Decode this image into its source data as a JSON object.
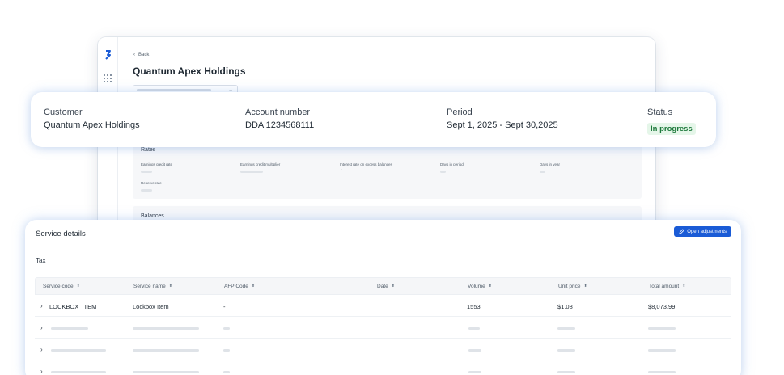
{
  "app": {
    "back_label": "Back",
    "company_title": "Quantum Apex Holdings",
    "rates_title": "Rates",
    "rates_labels": [
      "Earnings credit rate",
      "Earnings credit multiplier",
      "Interest rate on excess balances",
      "Days in period",
      "Days in year",
      "Reserve rate"
    ],
    "rates_dash": "-",
    "balances_title": "Balances"
  },
  "info": {
    "customer_label": "Customer",
    "customer_value": "Quantum Apex Holdings",
    "account_label": "Account number",
    "account_value": "DDA 1234568111",
    "period_label": "Period",
    "period_value": "Sept 1, 2025 - Sept 30,2025",
    "status_label": "Status",
    "status_value": "In progress"
  },
  "service": {
    "title": "Service details",
    "adjust_label": "Open adjustments",
    "tax_label": "Tax",
    "columns": [
      "Service code",
      "Service name",
      "AFP Code",
      "Date",
      "Volume",
      "Unit price",
      "Total amount"
    ],
    "row1": {
      "code": "LOCKBOX_ITEM",
      "name": "Lockbox Item",
      "afp": "-",
      "volume": "1553",
      "unit_price": "$1.08",
      "total": "$8,073.99"
    }
  },
  "colors": {
    "accent": "#1a5bd6",
    "status_bg": "#e5f6e9",
    "status_text": "#1e7a3c"
  }
}
